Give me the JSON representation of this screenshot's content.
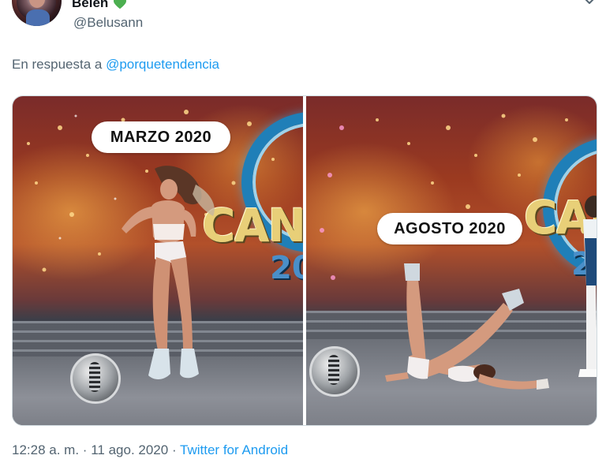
{
  "tweet": {
    "author": {
      "display_name": "Belen",
      "handle": "@Belusann",
      "name_emoji_icon": "green-heart-icon"
    },
    "reply": {
      "prefix": "En respuesta a",
      "mention": "@porquetendencia"
    },
    "media": {
      "left_caption": "MARZO 2020",
      "right_caption": "AGOSTO 2020",
      "show_logo_text": "CANT",
      "show_logo_year": "20"
    },
    "meta": {
      "time": "12:28 a. m.",
      "separator": "·",
      "date": "11 ago. 2020",
      "source": "Twitter for Android"
    }
  },
  "colors": {
    "link": "#1d9bf0",
    "secondary_text": "#536471",
    "heart": "#4caf50"
  }
}
